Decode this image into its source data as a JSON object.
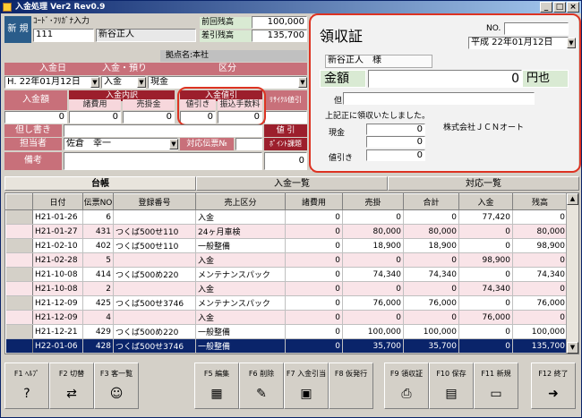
{
  "window": {
    "title": "入金処理 Ver2 Rev0.9",
    "min": "_",
    "max": "□",
    "close": "×"
  },
  "header": {
    "mode": "新 規",
    "kana_label": "ｺｰﾄﾞ･ﾌﾘｶﾞﾅ入力",
    "code": "111",
    "customer_name": "新谷正人",
    "prev_balance_label": "前回残高",
    "prev_balance": "100,000",
    "diff_balance_label": "差引残高",
    "diff_balance": "135,700"
  },
  "form": {
    "branch": "拠点名:本社",
    "labels": {
      "date": "入金日",
      "type": "入金・預り",
      "category": "区分",
      "amount": "入金額",
      "breakdown": "入金内訳",
      "fee": "諸費用",
      "sales": "売掛金",
      "discount": "入金値引",
      "discount_a": "値引き",
      "discount_b": "振込手数料",
      "rebate": "ﾘｻｲｸﾙ値引",
      "note": "但し書き",
      "slip": "値 引",
      "staff": "担当者",
      "counter_slip": "対応伝票№",
      "points": "ﾎﾟｲﾝﾄ課題",
      "remarks": "備考"
    },
    "values": {
      "date": "H. 22年01月12日",
      "type": "入金",
      "category": "現金",
      "amount": "0",
      "fee": "0",
      "sales": "0",
      "discount_a": "0",
      "discount_b": "0",
      "rebate": "",
      "staff": "佐倉　幸一",
      "points": "0"
    }
  },
  "receipt": {
    "title": "領収証",
    "no_label": "NO.",
    "date": "平成 22年01月12日",
    "recipient": "新谷正人　様",
    "amount_label": "金額",
    "amount": "0",
    "amount_suffix": "円也",
    "tadashi": "但",
    "thanks": "上記正に領収いたしました。",
    "company": "株式会社ＪＣＮオート",
    "cash_label": "現金",
    "cash_value": "0",
    "other_value": "0",
    "discount_label": "値引き",
    "discount_value": "0"
  },
  "tabs": [
    "台帳",
    "入金一覧",
    "対応一覧"
  ],
  "table": {
    "headers": [
      "日付",
      "伝票NO",
      "登録番号",
      "売上区分",
      "諸費用",
      "売掛",
      "合計",
      "入金",
      "残高"
    ],
    "rows": [
      [
        "H21-01-26",
        "6",
        "",
        "入金",
        "0",
        "0",
        "0",
        "77,420",
        "0"
      ],
      [
        "H21-01-27",
        "431",
        "つくば500せ110",
        "24ヶ月車検",
        "0",
        "80,000",
        "80,000",
        "0",
        "80,000"
      ],
      [
        "H21-02-10",
        "402",
        "つくば500せ110",
        "一般整備",
        "0",
        "18,900",
        "18,900",
        "0",
        "98,900"
      ],
      [
        "H21-02-28",
        "5",
        "",
        "入金",
        "0",
        "0",
        "0",
        "98,900",
        "0"
      ],
      [
        "H21-10-08",
        "414",
        "つくば500め220",
        "メンテナンスパック",
        "0",
        "74,340",
        "74,340",
        "0",
        "74,340"
      ],
      [
        "H21-10-08",
        "2",
        "",
        "入金",
        "0",
        "0",
        "0",
        "74,340",
        "0"
      ],
      [
        "H21-12-09",
        "425",
        "つくば500せ3746",
        "メンテナンスパック",
        "0",
        "76,000",
        "76,000",
        "0",
        "76,000"
      ],
      [
        "H21-12-09",
        "4",
        "",
        "入金",
        "0",
        "0",
        "0",
        "76,000",
        "0"
      ],
      [
        "H21-12-21",
        "429",
        "つくば500め220",
        "一般整備",
        "0",
        "100,000",
        "100,000",
        "0",
        "100,000"
      ],
      [
        "H22-01-06",
        "428",
        "つくば500せ3746",
        "一般整備",
        "0",
        "35,700",
        "35,700",
        "0",
        "135,700"
      ]
    ]
  },
  "fkeys": [
    {
      "label": "F1 ﾍﾙﾌﾟ",
      "icon": "help-icon",
      "glyph": "?"
    },
    {
      "label": "F2 切替",
      "icon": "switch-icon",
      "glyph": "⇄"
    },
    {
      "label": "F3 客一覧",
      "icon": "customers-icon",
      "glyph": "☺"
    },
    {
      "label": "F5 編集",
      "icon": "edit-icon",
      "glyph": "▦"
    },
    {
      "label": "F6 削除",
      "icon": "delete-icon",
      "glyph": "✎"
    },
    {
      "label": "F7 入金引当",
      "icon": "allocate-icon",
      "glyph": "▣"
    },
    {
      "label": "F8 仮発行",
      "icon": "provisional-icon",
      "glyph": ""
    },
    {
      "label": "F9 領収証",
      "icon": "printer-icon",
      "glyph": "⎙"
    },
    {
      "label": "F10 保存",
      "icon": "save-icon",
      "glyph": "▤"
    },
    {
      "label": "F11 新規",
      "icon": "new-icon",
      "glyph": "▭"
    },
    {
      "label": "F12 終了",
      "icon": "exit-icon",
      "glyph": "➜"
    }
  ],
  "colors": {
    "accent": "#0a246a",
    "label_red": "#c8707a",
    "dark_red": "#9c1f2c",
    "highlight": "#dd3322",
    "receipt_green": "#d9ead3"
  }
}
